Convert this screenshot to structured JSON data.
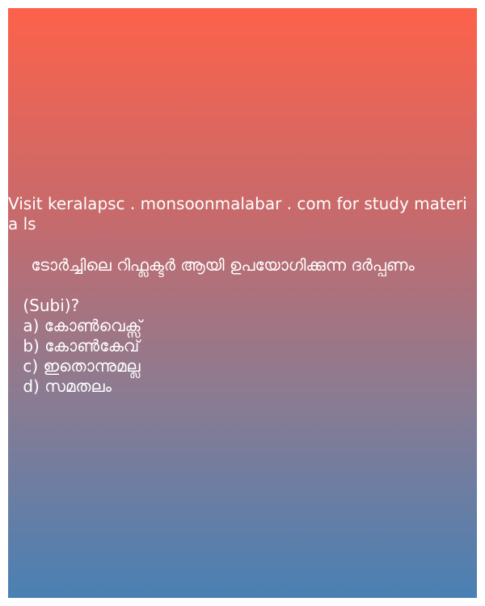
{
  "promo_text": "Visit keralapsc . monsoonmalabar . com for study materia ls",
  "question": " ടോർച്ചിലെ റിഫ്ലക്ടർ ആയി ഉപയോഗിക്കുന്ന ദർപ്പണം",
  "subject": " (Subi)?",
  "options": [
    {
      "label": " a) കോൺവെക്സ്"
    },
    {
      "label": " b) കോൺകേവ്"
    },
    {
      "label": " c) ഇതൊന്നുമല്ല"
    },
    {
      "label": " d) സമതലം"
    }
  ],
  "colors": {
    "gradient_top": "#fd624a",
    "gradient_bottom": "#4a80b4",
    "text": "#ffffff"
  }
}
